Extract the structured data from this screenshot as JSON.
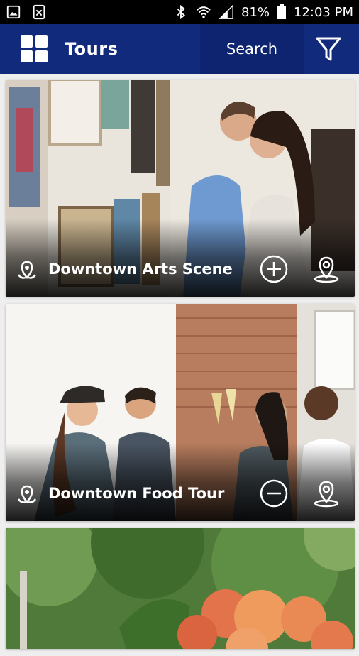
{
  "status_bar": {
    "battery": "81%",
    "time": "12:03 PM"
  },
  "app_bar": {
    "title": "Tours",
    "search_label": "Search"
  },
  "tours": [
    {
      "title": "Downtown Arts Scene",
      "action": "add"
    },
    {
      "title": "Downtown Food Tour",
      "action": "remove"
    },
    {
      "title": ""
    }
  ],
  "colors": {
    "app_bar": "#112a7c",
    "search_bg": "#0e2471"
  }
}
